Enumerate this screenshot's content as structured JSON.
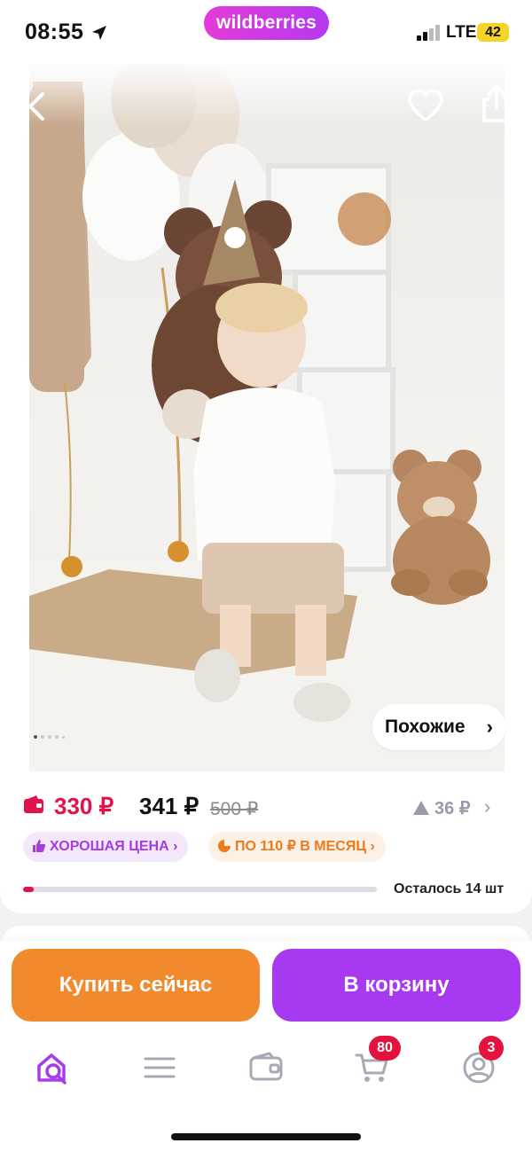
{
  "status_bar": {
    "time": "08:55",
    "brand": "wildberries",
    "network": "LTE",
    "battery": "42",
    "icons": [
      "location-arrow-icon",
      "signal-icon"
    ]
  },
  "product": {
    "photo_dots_total": 5,
    "photo_dot_active": 1,
    "similar_label": "Похожие",
    "icons": [
      "back-icon",
      "heart-icon",
      "share-icon"
    ]
  },
  "price": {
    "wallet_price": "330 ₽",
    "price": "341 ₽",
    "old_price": "500 ₽",
    "change": "36 ₽",
    "good_price_label": "ХОРОШАЯ ЦЕНА",
    "installment_label": "ПО 110 ₽ В МЕСЯЦ",
    "stock_text": "Осталось 14 шт",
    "stock_fill_fraction": 0.03,
    "colors": {
      "wallet": "#e3124a",
      "good": "#a63ce0",
      "installment": "#ee7a1c"
    }
  },
  "actions": {
    "buy_now": "Купить сейчас",
    "add_to_cart": "В корзину",
    "colors": {
      "buy": "#f08a2c",
      "cart": "#a73af0"
    }
  },
  "nav": {
    "items": [
      {
        "icon": "home-search-icon",
        "badge": ""
      },
      {
        "icon": "catalog-icon",
        "badge": ""
      },
      {
        "icon": "wallet-icon",
        "badge": ""
      },
      {
        "icon": "cart-icon",
        "badge": "80"
      },
      {
        "icon": "profile-icon",
        "badge": "3"
      }
    ]
  }
}
